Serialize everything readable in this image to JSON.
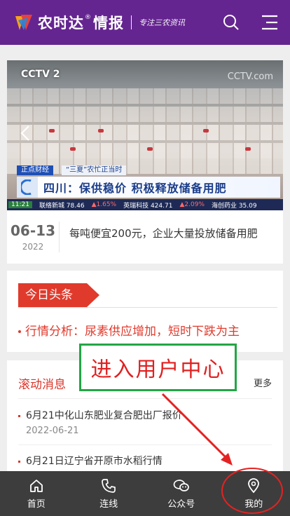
{
  "header": {
    "brand": "农时达",
    "brand_suffix": "情报",
    "slogan": "专注三农资讯",
    "bg_color": "#652590",
    "icons": [
      "search-icon",
      "menu-icon"
    ]
  },
  "banner": {
    "channel_logo": "CCTV 2",
    "watermark": "CCTV.com",
    "ticker_tag": "正点财经",
    "ticker_topic": "“三夏”农忙正当时",
    "ticker_headline": "四川：保供稳价 积极释放储备用肥",
    "stock_bar": {
      "time": "11:21",
      "items": [
        "联络新城 78.46",
        "▲1.65%",
        "英瑞科技 424.71",
        "▲2.09%",
        "海创药业 35.09"
      ]
    },
    "date_md": "06-13",
    "date_year": "2022",
    "caption": "每吨便宜200元，企业大量投放储备用肥"
  },
  "headline": {
    "tag": "今日头条",
    "item": "行情分析：尿素供应增加，短时下跌为主"
  },
  "news": {
    "title": "滚动消息",
    "more": "更多",
    "items": [
      {
        "text": "6月21中化山东肥业复合肥出厂报价",
        "date": "2022-06-21"
      },
      {
        "text": "6月21日辽宁省开原市水稻行情",
        "date": ""
      }
    ]
  },
  "overlay": {
    "label": "进入用户中心",
    "box_color": "#22a645",
    "text_color": "#e02020"
  },
  "bottom_nav": [
    {
      "label": "首页",
      "icon": "home-icon"
    },
    {
      "label": "连线",
      "icon": "phone-icon"
    },
    {
      "label": "公众号",
      "icon": "chat-icon"
    },
    {
      "label": "我的",
      "icon": "location-pin-icon"
    }
  ]
}
